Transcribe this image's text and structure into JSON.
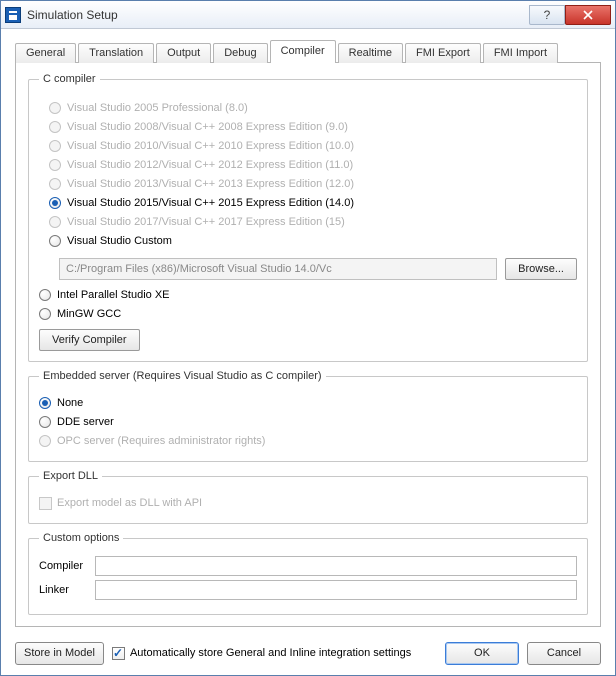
{
  "window": {
    "title": "Simulation Setup"
  },
  "tabs": [
    {
      "label": "General"
    },
    {
      "label": "Translation"
    },
    {
      "label": "Output"
    },
    {
      "label": "Debug"
    },
    {
      "label": "Compiler"
    },
    {
      "label": "Realtime"
    },
    {
      "label": "FMI Export"
    },
    {
      "label": "FMI Import"
    }
  ],
  "active_tab": "Compiler",
  "c_compiler": {
    "legend": "C compiler",
    "options": [
      {
        "label": "Visual Studio 2005 Professional (8.0)",
        "enabled": false,
        "selected": false
      },
      {
        "label": "Visual Studio 2008/Visual C++ 2008 Express Edition (9.0)",
        "enabled": false,
        "selected": false
      },
      {
        "label": "Visual Studio 2010/Visual C++ 2010 Express Edition (10.0)",
        "enabled": false,
        "selected": false
      },
      {
        "label": "Visual Studio 2012/Visual C++ 2012 Express Edition (11.0)",
        "enabled": false,
        "selected": false
      },
      {
        "label": "Visual Studio 2013/Visual C++ 2013 Express Edition (12.0)",
        "enabled": false,
        "selected": false
      },
      {
        "label": "Visual Studio 2015/Visual C++ 2015 Express Edition (14.0)",
        "enabled": true,
        "selected": true
      },
      {
        "label": "Visual Studio 2017/Visual C++ 2017 Express Edition (15)",
        "enabled": false,
        "selected": false
      },
      {
        "label": "Visual Studio Custom",
        "enabled": true,
        "selected": false
      }
    ],
    "path_value": "C:/Program Files (x86)/Microsoft Visual Studio 14.0/Vc",
    "browse_label": "Browse...",
    "extra_options": [
      {
        "label": "Intel Parallel Studio XE",
        "enabled": true,
        "selected": false
      },
      {
        "label": "MinGW GCC",
        "enabled": true,
        "selected": false
      }
    ],
    "verify_label": "Verify Compiler"
  },
  "embedded_server": {
    "legend": "Embedded server (Requires Visual Studio as C compiler)",
    "options": [
      {
        "label": "None",
        "enabled": true,
        "selected": true
      },
      {
        "label": "DDE server",
        "enabled": true,
        "selected": false
      },
      {
        "label": "OPC server (Requires administrator rights)",
        "enabled": false,
        "selected": false
      }
    ]
  },
  "export_dll": {
    "legend": "Export DLL",
    "checkbox_label": "Export model as DLL with API",
    "enabled": false,
    "checked": false
  },
  "custom_options": {
    "legend": "Custom options",
    "compiler_label": "Compiler",
    "compiler_value": "",
    "linker_label": "Linker",
    "linker_value": ""
  },
  "footer": {
    "store_label": "Store in Model",
    "auto_store_label": "Automatically store General and Inline integration settings",
    "auto_store_checked": true,
    "ok_label": "OK",
    "cancel_label": "Cancel"
  }
}
